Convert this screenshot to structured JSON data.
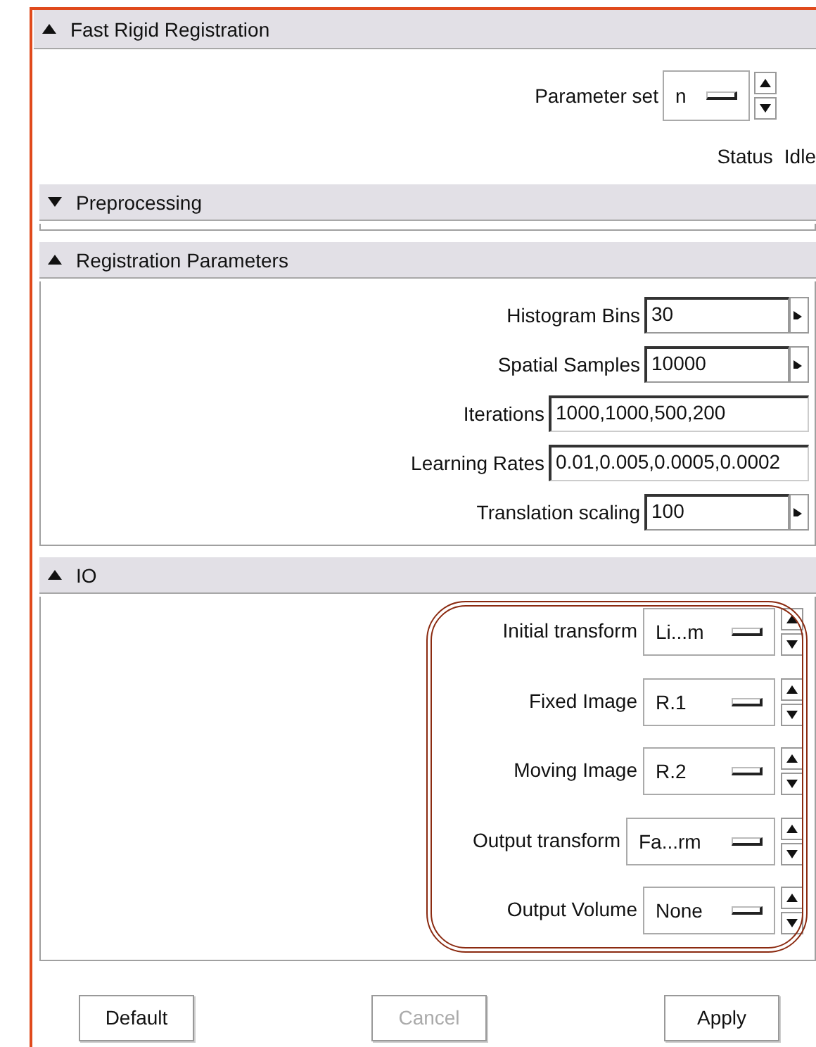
{
  "panel": {
    "title": "Fast Rigid Registration",
    "expanded": true
  },
  "parameter_set": {
    "label": "Parameter set",
    "value": "n"
  },
  "status": {
    "label": "Status",
    "value": "Idle"
  },
  "sections": [
    {
      "title": "Preprocessing",
      "expanded": false,
      "highlighted": false
    },
    {
      "title": "Registration Parameters",
      "expanded": true,
      "highlighted": false,
      "rows": [
        {
          "kind": "spin",
          "label": "Histogram Bins",
          "value": "30"
        },
        {
          "kind": "spin",
          "label": "Spatial Samples",
          "value": "10000"
        },
        {
          "kind": "text",
          "label": "Iterations",
          "value": "1000,1000,500,200"
        },
        {
          "kind": "text",
          "label": "Learning Rates",
          "value": "0.01,0.005,0.0005,0.0002"
        },
        {
          "kind": "spin",
          "label": "Translation scaling",
          "value": "100"
        }
      ]
    },
    {
      "title": "IO",
      "expanded": true,
      "highlighted": true,
      "rows": [
        {
          "kind": "combo",
          "label": "Initial transform",
          "value": "Li...m",
          "wide": false
        },
        {
          "kind": "combo",
          "label": "Fixed Image",
          "value": "R.1",
          "wide": false
        },
        {
          "kind": "combo",
          "label": "Moving Image",
          "value": "R.2",
          "wide": false
        },
        {
          "kind": "combo",
          "label": "Output transform",
          "value": "Fa...rm",
          "wide": true
        },
        {
          "kind": "combo",
          "label": "Output Volume",
          "value": "None",
          "wide": false
        }
      ]
    }
  ],
  "buttons": [
    {
      "label": "Default",
      "disabled": false
    },
    {
      "label": "Cancel",
      "disabled": true
    },
    {
      "label": "Apply",
      "disabled": false
    }
  ]
}
